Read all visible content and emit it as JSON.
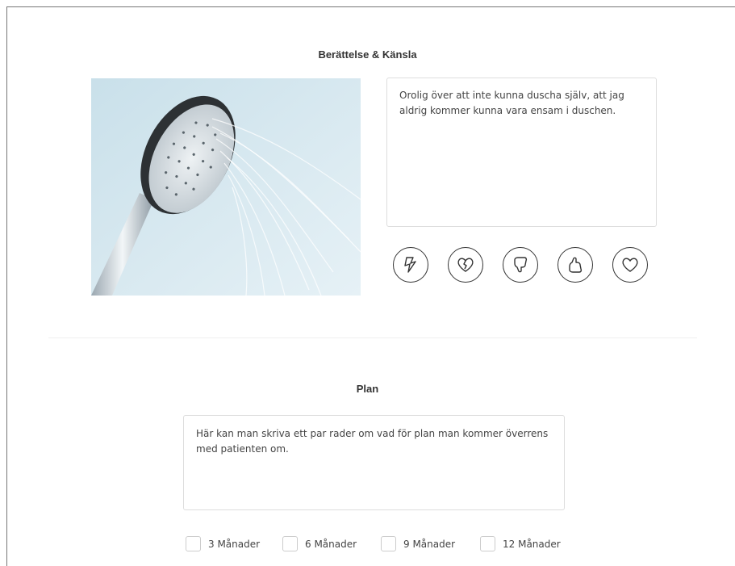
{
  "story": {
    "title": "Berättelse & Känsla",
    "text": "Orolig över att inte kunna duscha själv, att jag aldrig kommer kunna vara ensam i duschen.",
    "feelings": [
      {
        "icon": "lightning-icon"
      },
      {
        "icon": "broken-heart-icon"
      },
      {
        "icon": "thumbs-down-icon"
      },
      {
        "icon": "thumbs-up-icon"
      },
      {
        "icon": "heart-icon"
      }
    ]
  },
  "plan": {
    "title": "Plan",
    "text": "Här kan man skriva ett par rader om vad för plan man kommer överrens med patienten om.",
    "periods": [
      {
        "label": "3 Månader"
      },
      {
        "label": "6 Månader"
      },
      {
        "label": "9 Månader"
      },
      {
        "label": "12 Månader"
      }
    ]
  }
}
